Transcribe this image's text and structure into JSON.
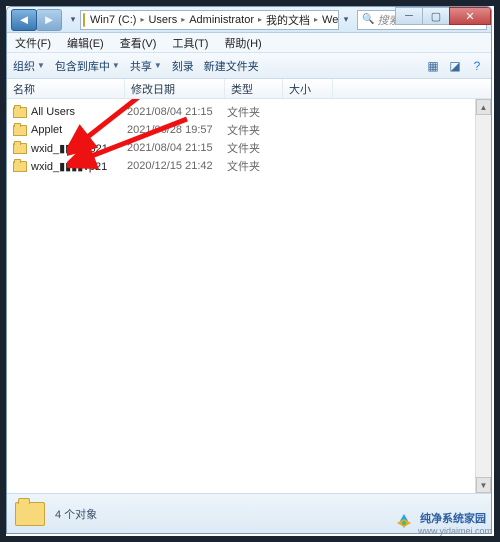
{
  "titlebar": {
    "breadcrumb": [
      "Win7 (C:)",
      "Users",
      "Administrator",
      "我的文档",
      "WeChat Files"
    ],
    "search_placeholder": "搜索 WeChat Files"
  },
  "menubar": {
    "file": "文件(F)",
    "edit": "编辑(E)",
    "view": "查看(V)",
    "tools": "工具(T)",
    "help": "帮助(H)"
  },
  "toolbar": {
    "organize": "组织",
    "include": "包含到库中",
    "share": "共享",
    "burn": "刻录",
    "new_folder": "新建文件夹"
  },
  "columns": {
    "name": "名称",
    "date": "修改日期",
    "type": "类型",
    "size": "大小"
  },
  "rows": [
    {
      "name": "All Users",
      "date": "2021/08/04 21:15",
      "type": "文件夹"
    },
    {
      "name": "Applet",
      "date": "2021/06/28 19:57",
      "type": "文件夹"
    },
    {
      "name": "wxid_▮▮▮▮2821",
      "date": "2021/08/04 21:15",
      "type": "文件夹"
    },
    {
      "name": "wxid_▮▮▮▮vp21",
      "date": "2020/12/15 21:42",
      "type": "文件夹"
    }
  ],
  "statusbar": {
    "count_label": "4 个对象"
  },
  "watermark": {
    "title": "纯净系统家园",
    "url": "www.yidaimei.com"
  }
}
